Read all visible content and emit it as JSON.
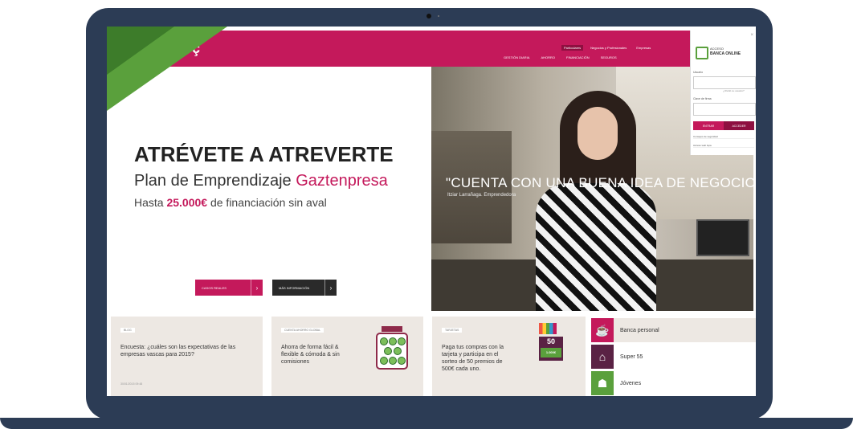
{
  "header": {
    "logo_main": "LABORAL",
    "logo_sub": "kutxa",
    "top_tabs": [
      "Particulares",
      "Negocios y Profesionales",
      "Empresas"
    ],
    "main_nav": [
      "GESTIÓN DIARIA",
      "AHORRO",
      "FINANCIACIÓN",
      "SEGUROS"
    ]
  },
  "hero": {
    "title": "ATRÉVETE A ATREVERTE",
    "subtitle_prefix": "Plan de Emprendizaje ",
    "subtitle_accent": "Gaztenpresa",
    "line3_prefix": "Hasta ",
    "line3_amount": "25.000€",
    "line3_suffix": " de financiación sin aval",
    "btn_cases": "CASOS REALES",
    "btn_info": "MÁS INFORMACIÓN",
    "quote": "\"CUENTA CON UNA BUENA IDEA DE NEGOCIO\"",
    "quote_sub": "Itziar Larrañaga. Emprendedora"
  },
  "login": {
    "title_small": "ACCESO",
    "title_big": "BANCA ONLINE",
    "user_label": "Usuario",
    "forgot": "¿Olvidó su usuario?",
    "password_label": "Clave de firma",
    "enter_label": "ENTRAR",
    "access_label": "ACCEDER",
    "link1": "Consejos de seguridad",
    "link2": "Acceso web lupa"
  },
  "tiles": [
    {
      "tag": "BLOG",
      "text": "Encuesta: ¿cuáles son las expectativas de las empresas vascas para 2015?",
      "date": "30/01/2015 09:48"
    },
    {
      "tag": "CUENTA AHORRO GLOBAL",
      "text": "Ahorra de forma fácil & flexible & cómoda & sin comisiones"
    },
    {
      "tag": "TARJETAS",
      "text": "Paga tus compras con la tarjeta y participa en el sorteo de 50 premios de 500€ cada uno.",
      "prize_top": "50",
      "prize_bottom": "1.000€"
    }
  ],
  "side_links": [
    "Banca personal",
    "Super 55",
    "Jóvenes"
  ],
  "colors": {
    "brand": "#c4195b",
    "green": "#5aa03c",
    "frame": "#2c3c55"
  }
}
